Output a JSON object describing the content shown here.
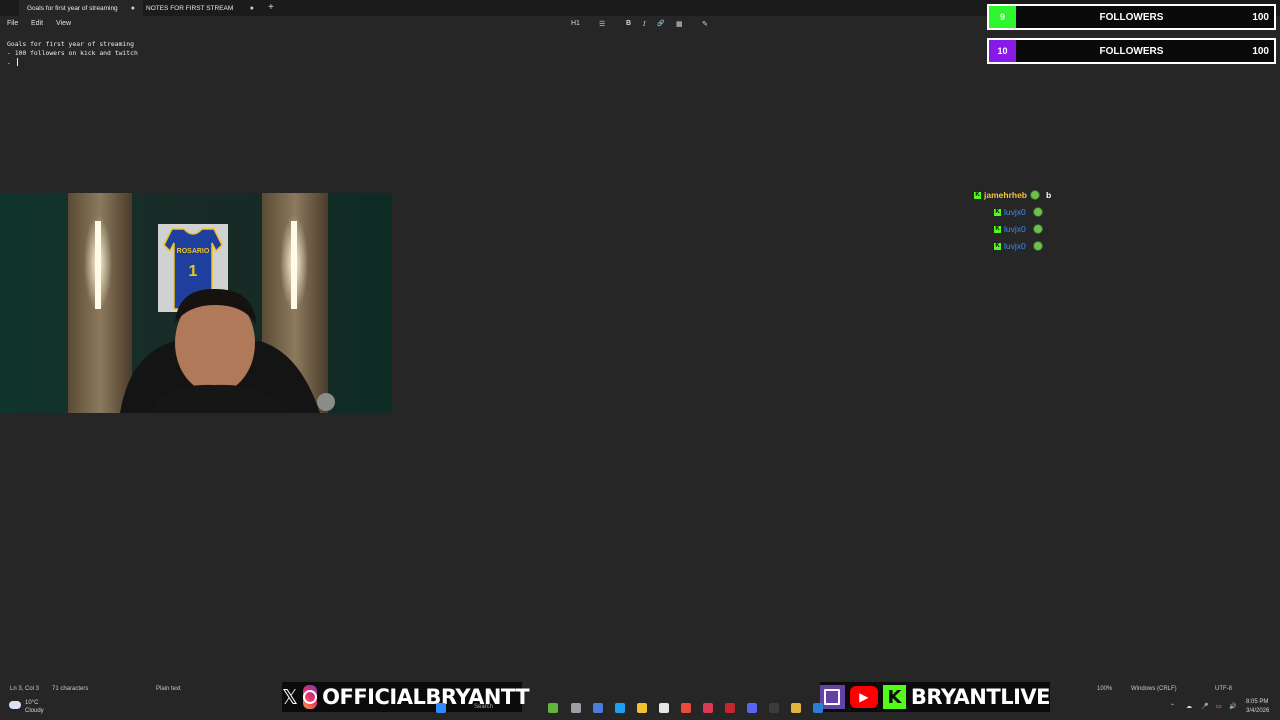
{
  "notepad": {
    "tabs": [
      {
        "label": "Goals for first year of streaming",
        "indicator": "●"
      },
      {
        "label": "NOTES FOR FIRST STREAM",
        "indicator": "●"
      }
    ],
    "new_tab": "+",
    "menu": [
      "File",
      "Edit",
      "View"
    ],
    "format_toolbar": {
      "heading": "H1",
      "list": "☰",
      "bold": "B",
      "italic": "I",
      "link": "🔗",
      "table": "▦",
      "clear": "✎"
    },
    "content": {
      "line1": "Goals for first year of streaming",
      "line2": "- 100 followers on kick and twitch",
      "line3": "- "
    },
    "status_bar": {
      "position": "Ln 3, Col 3",
      "characters": "71 characters",
      "format": "Plain text",
      "zoom": "100%",
      "line_ending": "Windows (CRLF)",
      "encoding": "UTF-8"
    }
  },
  "follower_goals": [
    {
      "count": "9",
      "label": "FOLLOWERS",
      "target": "100",
      "color": "#2ef52e"
    },
    {
      "count": "10",
      "label": "FOLLOWERS",
      "target": "100",
      "color": "#8a18e8"
    }
  ],
  "chat": [
    {
      "user": "jamehrheb",
      "color": "#f4c542",
      "message": "b"
    },
    {
      "user": "luvjx0",
      "color": "#3d8bff",
      "message": ""
    },
    {
      "user": "luvjx0",
      "color": "#3d8bff",
      "message": ""
    },
    {
      "user": "luvjx0",
      "color": "#3d8bff",
      "message": ""
    }
  ],
  "webcam": {
    "jersey_name": "ROSARIO",
    "jersey_number": "1"
  },
  "socials": {
    "left_handle": "OFFICIALBRYANTT",
    "left_icons": [
      "x-icon",
      "instagram-icon"
    ],
    "right_handle": "BRYANTLIVE",
    "right_icons": [
      "twitch-icon",
      "youtube-icon",
      "kick-icon"
    ]
  },
  "taskbar": {
    "weather_temp": "10°C",
    "weather_desc": "Cloudy",
    "search": "Search",
    "time": "8:05 PM",
    "date": "3/4/2026"
  },
  "colors": {
    "background": "#262626",
    "kick_green": "#53fc18"
  }
}
